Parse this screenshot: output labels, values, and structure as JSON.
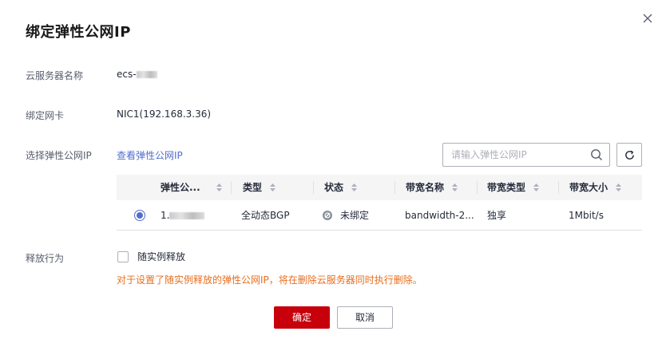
{
  "dialog": {
    "title": "绑定弹性公网IP",
    "close_icon": "close-icon"
  },
  "server_name": {
    "label": "云服务器名称",
    "value": "ecs-"
  },
  "nic": {
    "label": "绑定网卡",
    "value": "NIC1(192.168.3.36)"
  },
  "eip_select": {
    "label": "选择弹性公网IP",
    "link": "查看弹性公网IP",
    "search_placeholder": "请输入弹性公网IP",
    "search_icon": "search-icon",
    "refresh_icon": "refresh-icon"
  },
  "table": {
    "columns": [
      "弹性公...",
      "类型",
      "状态",
      "带宽名称",
      "带宽类型",
      "带宽大小"
    ],
    "rows": [
      {
        "selected": true,
        "ip": "1.",
        "type": "全动态BGP",
        "status": "未绑定",
        "bandwidth_name": "bandwidth-2...",
        "bandwidth_type": "独享",
        "bandwidth_size": "1Mbit/s"
      }
    ]
  },
  "release": {
    "label": "释放行为",
    "checkbox_label": "随实例释放",
    "checked": false,
    "warning": "对于设置了随实例释放的弹性公网IP，将在删除云服务器同时执行删除。"
  },
  "footer": {
    "confirm": "确定",
    "cancel": "取消"
  },
  "colors": {
    "primary": "#c7000b",
    "link": "#526ecc",
    "warning": "#e86e1f"
  }
}
